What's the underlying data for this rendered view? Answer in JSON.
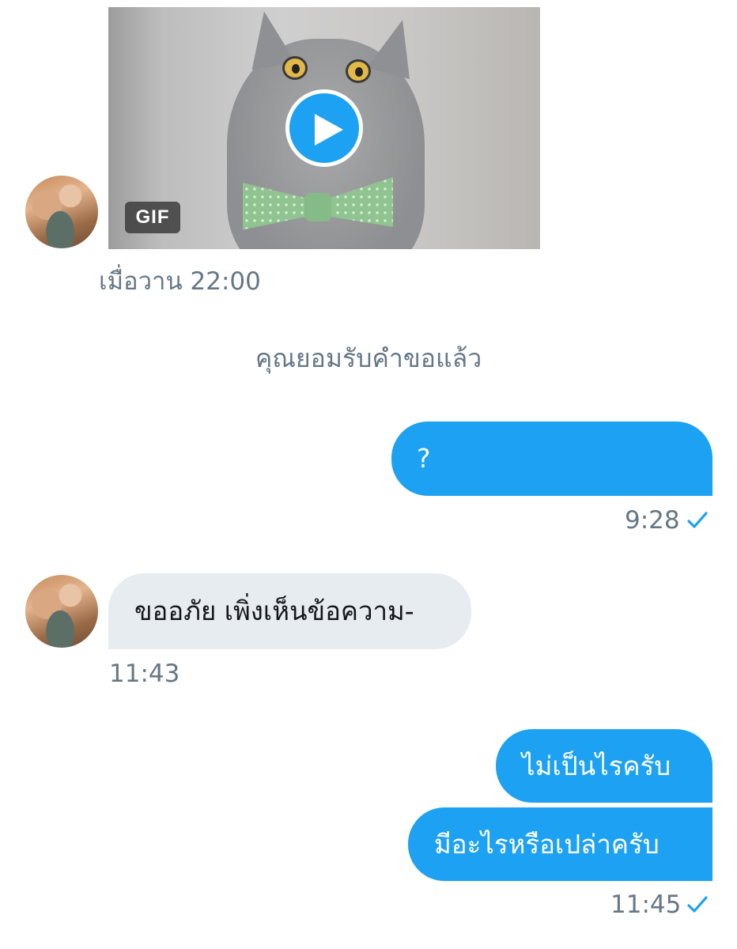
{
  "conversation": {
    "gif_message": {
      "badge": "GIF",
      "timestamp": "เมื่อวาน 22:00"
    },
    "system_note": "คุณยอมรับคำขอแล้ว",
    "messages": [
      {
        "direction": "outgoing",
        "text": "?",
        "timestamp": "9:28",
        "status_icon": "sent-check-icon"
      },
      {
        "direction": "incoming",
        "text": "ขออภัย เพิ่งเห็นข้อความ-",
        "timestamp": "11:43"
      },
      {
        "direction": "outgoing",
        "text": "ไม่เป็นไรครับ"
      },
      {
        "direction": "outgoing",
        "text": "มีอะไรหรือเปล่าครับ",
        "timestamp": "11:45",
        "status_icon": "sent-check-icon"
      }
    ]
  },
  "colors": {
    "outgoing_bubble": "#1da1f2",
    "incoming_bubble": "#e6ecf0",
    "meta_text": "#657786",
    "accent": "#1da1f2"
  }
}
